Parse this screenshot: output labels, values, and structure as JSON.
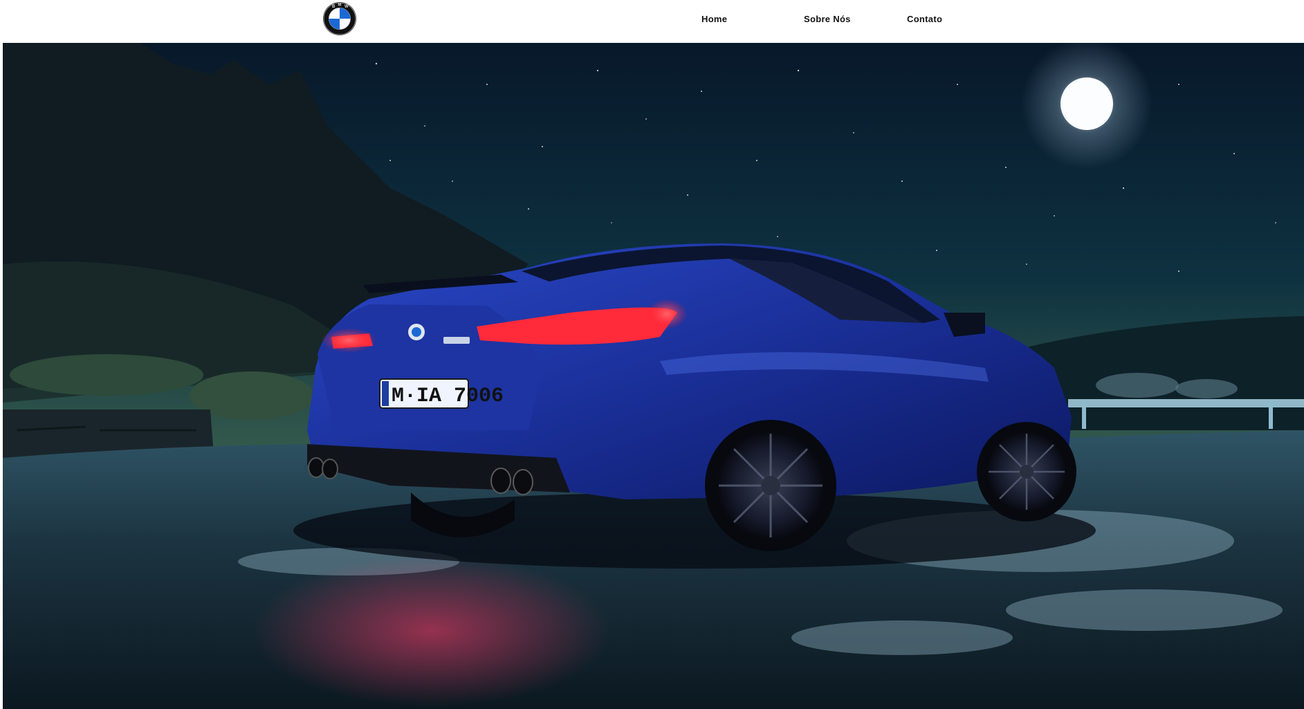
{
  "header": {
    "logo_icon": "bmw-roundel-logo",
    "logo_letters": "BMW",
    "nav": [
      {
        "label": "Home"
      },
      {
        "label": "Sobre Nós"
      },
      {
        "label": "Contato"
      }
    ]
  },
  "hero": {
    "image": "night-scene-blue-coupe",
    "license_plate": "M·IA 7006",
    "colors": {
      "car": "#1f3ab0",
      "sky_top": "#07182a",
      "sky_horizon": "#5a7a52",
      "tail_light": "#ff2a3a"
    }
  }
}
